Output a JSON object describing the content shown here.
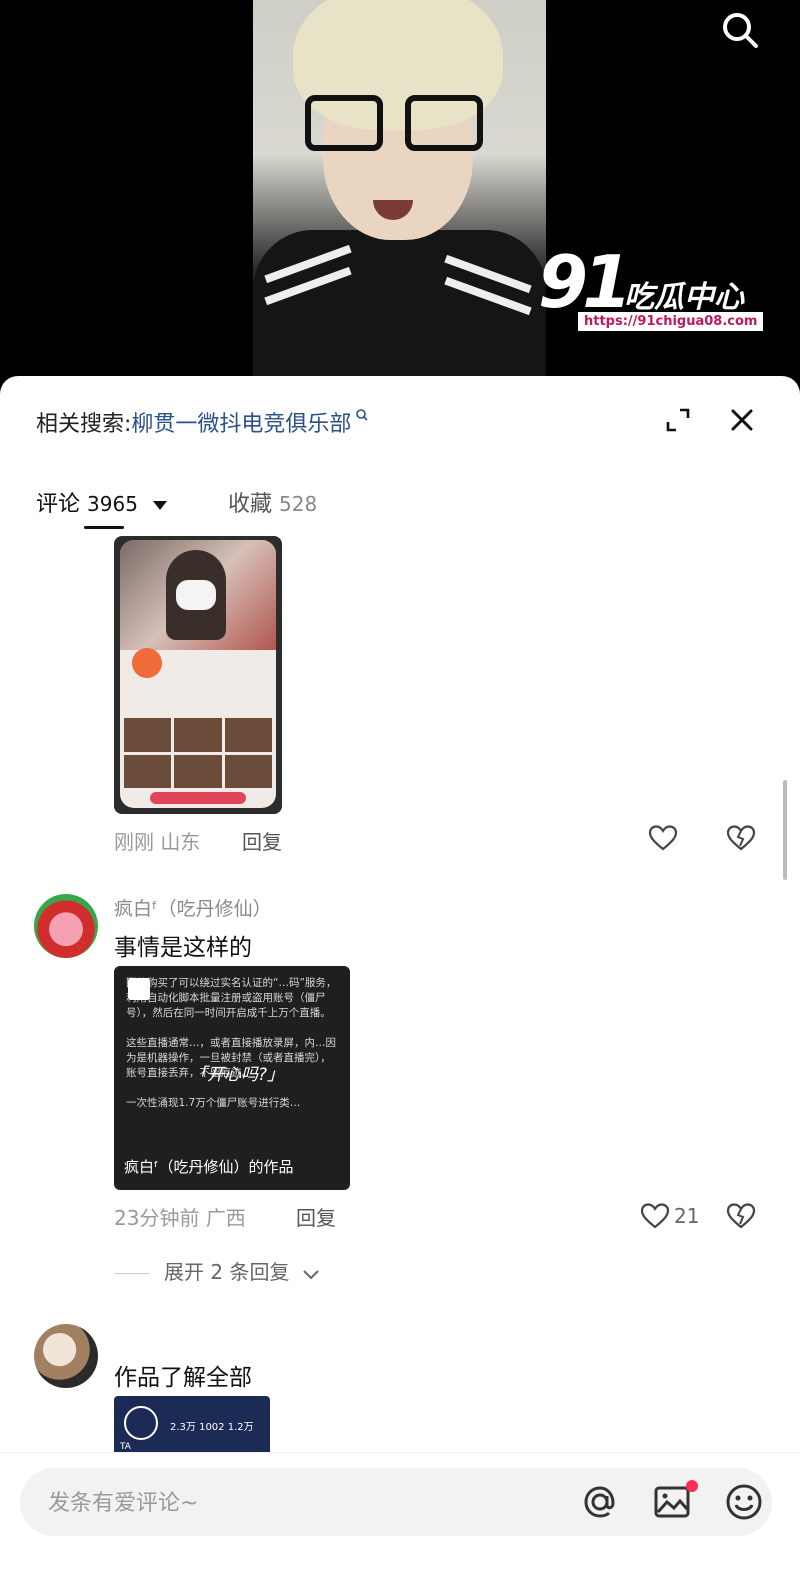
{
  "watermark": {
    "logo_num": "91",
    "logo_text": "吃瓜中心",
    "url": "https://91chigua08.com"
  },
  "header": {
    "related_label": "相关搜索:",
    "related_query": "柳贯一微抖电竞俱乐部"
  },
  "tabs": {
    "comments_label": "评论",
    "comments_count": "3965",
    "favorites_label": "收藏",
    "favorites_count": "528"
  },
  "comments": [
    {
      "time": "刚刚",
      "location": "山东",
      "reply_label": "回复"
    },
    {
      "username": "疯白ᶠ（吃丹修仙）",
      "text": "事情是这样的",
      "media_text": "团伙购买了可以绕过实名认证的“…码”服务，利用自动化脚本批量注册或盗用账号（僵尸号），然后在同一时间开启成千上万个直播。\n\n这些直播通常…，或者直接播放录屏，内…因为是机器操作，一旦被封禁（或者直播完），账号直接丢弃，不留痕迹。\n\n一次性涌现1.7万个僵尸账号进行类…",
      "media_center": "「开心吗?」",
      "media_caption": "疯白ᶠ（吃丹修仙）的作品",
      "time": "23分钟前",
      "location": "广西",
      "reply_label": "回复",
      "likes": "21",
      "expand_label": "展开 2 条回复"
    },
    {
      "text": "作品了解全部",
      "media_stats": "2.3万   1002   1.2万",
      "media_ta": "TA"
    }
  ],
  "input": {
    "placeholder": "发条有爱评论~"
  },
  "icons": {
    "search": "search-icon",
    "expand": "expand-icon",
    "close": "close-icon",
    "like": "heart-icon",
    "dislike": "broken-heart-icon",
    "at": "at-icon",
    "image": "image-icon",
    "emoji": "emoji-icon"
  },
  "colors": {
    "accent": "#fe2c55",
    "link": "#2a4f8a",
    "bg": "#ffffff"
  }
}
